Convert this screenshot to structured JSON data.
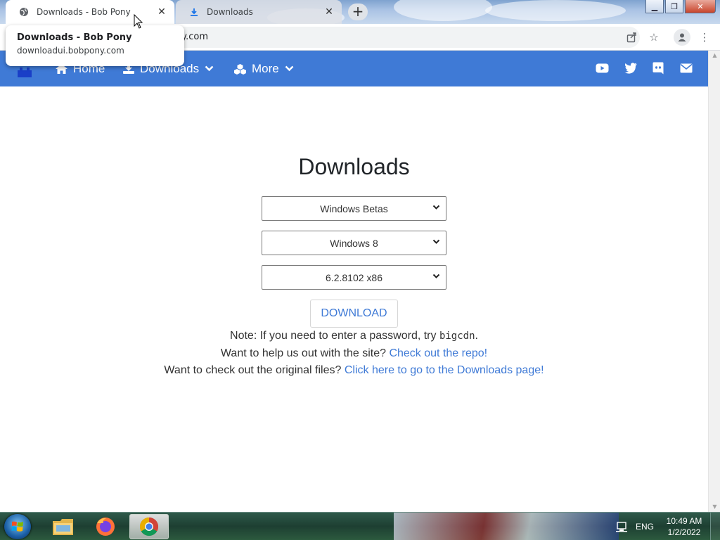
{
  "browser": {
    "tabs": [
      {
        "title": "Downloads - Bob Pony",
        "icon": "globe-icon",
        "active": true
      },
      {
        "title": "Downloads",
        "icon": "download-icon",
        "active": false
      }
    ],
    "new_tab_label": "+",
    "address": "ny.com",
    "tooltip": {
      "title": "Downloads - Bob Pony",
      "url": "downloadui.bobpony.com"
    }
  },
  "navbar": {
    "color": "#3f7ad6",
    "home": "Home",
    "downloads": "Downloads",
    "more": "More",
    "social": [
      "youtube-icon",
      "twitter-icon",
      "discord-icon",
      "mail-icon"
    ]
  },
  "main": {
    "heading": "Downloads",
    "selects": [
      {
        "value": "Windows Betas"
      },
      {
        "value": "Windows 8"
      },
      {
        "value": "6.2.8102 x86"
      }
    ],
    "download_button": "DOWNLOAD",
    "note_prefix": "Note: If you need to enter a password, try ",
    "note_password": "bigcdn",
    "note_suffix": ".",
    "help_prefix": "Want to help us out with the site? ",
    "help_link": "Check out the repo!",
    "orig_prefix": "Want to check out the original files? ",
    "orig_link": "Click here to go to the Downloads page!"
  },
  "taskbar": {
    "apps": [
      "windows-explorer-icon",
      "firefox-icon",
      "chrome-icon"
    ],
    "language": "ENG",
    "time": "10:49 AM",
    "date": "1/2/2022"
  }
}
